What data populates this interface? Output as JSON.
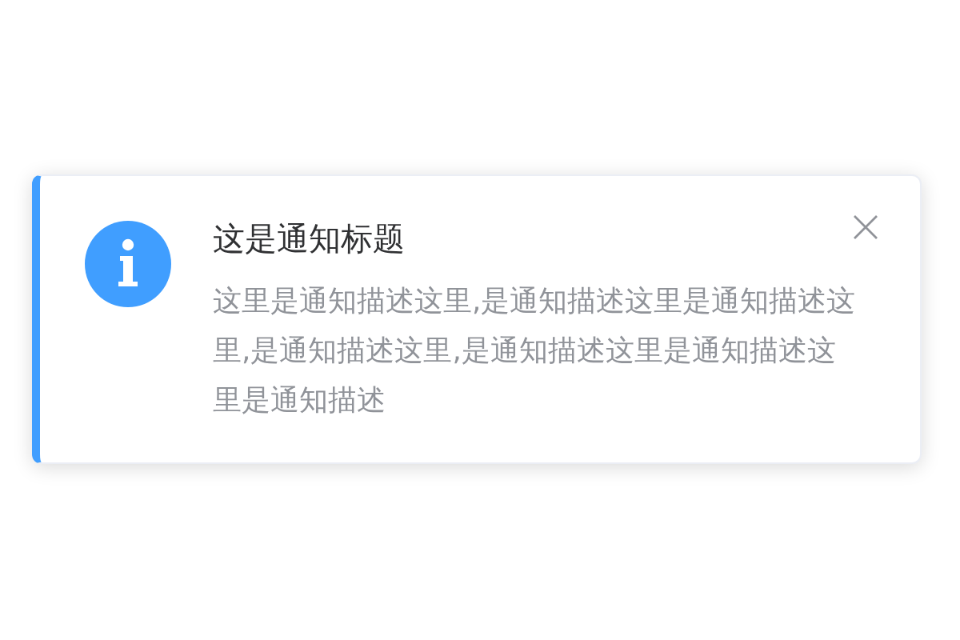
{
  "notification": {
    "kind": "info",
    "title": "这是通知标题",
    "description": "这里是通知描述这里,是通知描述这里是通知描述这里,是通知描述这里,是通知描述这里是通知描述这里是通知描述",
    "closable": true
  }
}
